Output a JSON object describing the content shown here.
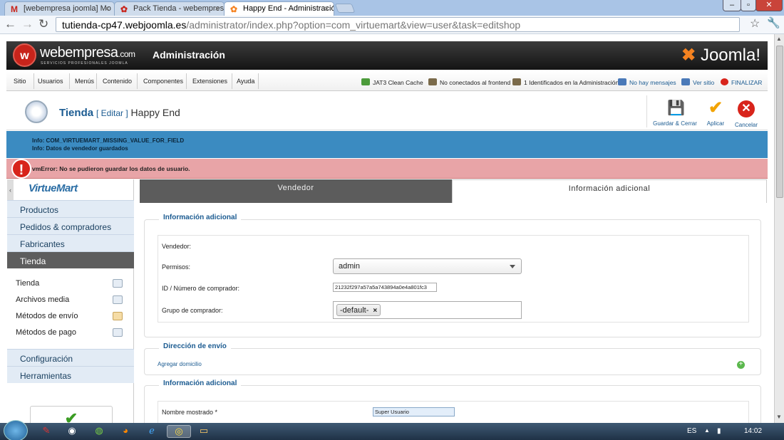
{
  "browser": {
    "tabs": [
      {
        "label": "[webempresa joomla] Mo",
        "icon": "M"
      },
      {
        "label": "Pack Tienda - webempres",
        "icon": "✿"
      },
      {
        "label": "Happy End - Administració",
        "icon": "✿"
      }
    ],
    "url_domain": "tutienda-cp47.webjoomla.es",
    "url_path": "/administrator/index.php?option=com_virtuemart&view=user&task=editshop"
  },
  "header": {
    "brand_main": "webempresa",
    "brand_suffix": ".com",
    "brand_sub": "SERVICIOS PROFESIONALES JOOMLA",
    "admin_title": "Administración",
    "joomla": "Joomla!"
  },
  "menu": {
    "items": [
      "Sitio",
      "Usuarios",
      "Menús",
      "Contenido",
      "Componentes",
      "Extensiones",
      "Ayuda"
    ],
    "status": [
      {
        "label": "JAT3 Clean Cache",
        "color": "#4c9b3b"
      },
      {
        "label": "No conectados al frontend",
        "color": "#7a6a4a"
      },
      {
        "label": "1 Identificados en la Administración",
        "color": "#7a6a4a"
      },
      {
        "label": "No hay mensajes",
        "color": "#4a79b8"
      },
      {
        "label": "Ver sitio",
        "color": "#4a79b8"
      },
      {
        "label": "FINALIZAR",
        "color": "#d8241b"
      }
    ]
  },
  "toolbar": {
    "title_main": "Tienda",
    "title_edit": "[ Editar ]",
    "title_name": "Happy End",
    "buttons": {
      "save_close": "Guardar & Cerrar",
      "apply": "Aplicar",
      "cancel": "Cancelar"
    }
  },
  "messages": {
    "info1": "Info: COM_VIRTUEMART_MISSING_VALUE_FOR_FIELD",
    "info2": "Info: Datos de vendedor guardados",
    "error": "vmError: No se pudieron guardar los datos de usuario."
  },
  "sidebar": {
    "logo": "VirtueMart",
    "sections": [
      "Productos",
      "Pedidos & compradores",
      "Fabricantes",
      "Tienda",
      "Configuración",
      "Herramientas"
    ],
    "subitems": [
      "Tienda",
      "Archivos media",
      "Métodos de envío",
      "Métodos de pago"
    ]
  },
  "main": {
    "tabs": [
      "Vendedor",
      "Información adicional"
    ],
    "fieldset1": {
      "legend": "Información adicional",
      "vendor_label": "Vendedor:",
      "permissions_label": "Permisos:",
      "permissions_value": "admin",
      "buyer_id_label": "ID / Número de comprador:",
      "buyer_id_value": "21232f297a57a5a743894a0e4a801fc3",
      "group_label": "Grupo de comprador:",
      "group_tag": "-default-",
      "tag_remove": "×"
    },
    "fieldset2": {
      "legend": "Dirección de envío",
      "add_address": "Agregar domicilio",
      "add_icon": "+"
    },
    "fieldset3": {
      "legend": "Información adicional",
      "display_name_label": "Nombre mostrado *",
      "display_name_value": "Super Usuario"
    }
  },
  "taskbar": {
    "lang": "ES",
    "time": "14:02"
  }
}
